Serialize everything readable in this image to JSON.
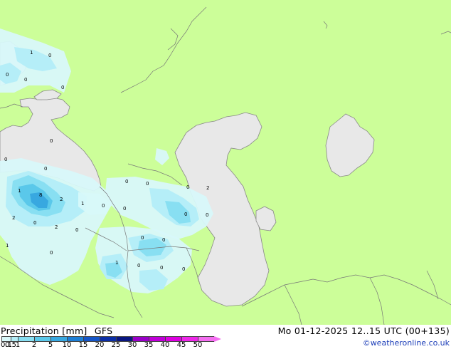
{
  "header": {
    "product": "Precipitation [mm]",
    "model": "GFS",
    "valid_time": "Mo 01-12-2025 12..15 UTC (00+135)"
  },
  "credit": "©weatheronline.co.uk",
  "colors": {
    "land": "#ccfe99",
    "water": "#e8e8e8",
    "coast": "#888888"
  },
  "legend": {
    "labels": [
      "0.1",
      "0.5",
      "1",
      "2",
      "5",
      "10",
      "15",
      "20",
      "25",
      "30",
      "35",
      "40",
      "45",
      "50"
    ],
    "colors": [
      "#d8f8fa",
      "#b5eef8",
      "#88dff2",
      "#5ac8ea",
      "#38a8e0",
      "#1e7fd6",
      "#1556c8",
      "#0b2ea6",
      "#0a1680",
      "#9a00c8",
      "#c000d8",
      "#dd00e0",
      "#ee28e8",
      "#f46ef0"
    ]
  },
  "map_labels": [
    "1",
    "0",
    "0",
    "0",
    "0",
    "0",
    "0",
    "0",
    "1",
    "8",
    "2",
    "1",
    "0",
    "0",
    "0",
    "0",
    "0",
    "2",
    "0",
    "0",
    "2",
    "0",
    "2",
    "0",
    "0",
    "0",
    "1",
    "0",
    "1",
    "0",
    "0",
    "0"
  ]
}
